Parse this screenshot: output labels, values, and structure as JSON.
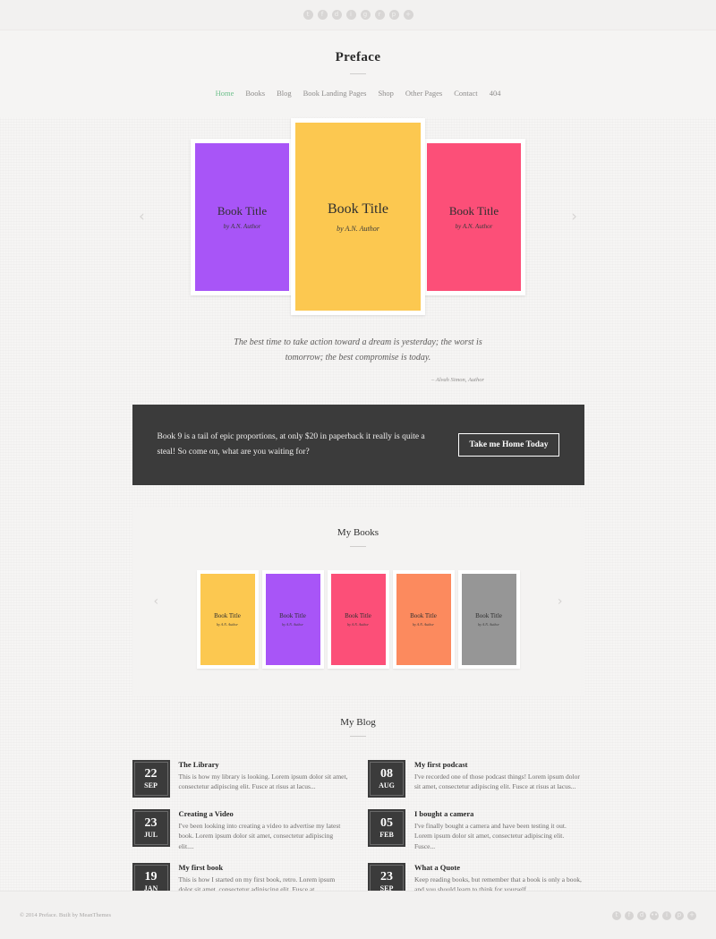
{
  "topbar": {
    "social_icons": [
      "twitter-icon",
      "facebook-icon",
      "dribbble-icon",
      "instagram-icon",
      "github-icon",
      "reddit-icon",
      "pinterest-icon",
      "google-plus-icon"
    ],
    "glyphs": [
      "t",
      "f",
      "d",
      "i",
      "g",
      "r",
      "p",
      "+"
    ]
  },
  "header": {
    "brand": "Preface",
    "nav": [
      {
        "label": "Home",
        "active": true
      },
      {
        "label": "Books",
        "active": false
      },
      {
        "label": "Blog",
        "active": false
      },
      {
        "label": "Book Landing Pages",
        "active": false
      },
      {
        "label": "Shop",
        "active": false
      },
      {
        "label": "Other Pages",
        "active": false
      },
      {
        "label": "Contact",
        "active": false
      },
      {
        "label": "404",
        "active": false
      }
    ],
    "active_color": "#6dbf8b"
  },
  "hero": {
    "prev_arrow": "‹",
    "next_arrow": "›",
    "books": [
      {
        "title": "Book Title",
        "author": "by A.N. Author",
        "color": "#A855F7"
      },
      {
        "title": "Book Title",
        "author": "by A.N. Author",
        "color": "#FCC850"
      },
      {
        "title": "Book Title",
        "author": "by A.N. Author",
        "color": "#FC4F78"
      }
    ]
  },
  "quote": {
    "text": "The best time to take action toward a dream is yesterday; the worst is tomorrow; the best compromise is today.",
    "attribution": "– Alvah Simon, Author"
  },
  "cta": {
    "text": "Book 9 is a tail of epic proportions, at only $20 in paperback it really is quite a steal! So come on, what are you waiting for?",
    "button_label": "Take me Home Today",
    "background": "#3b3b3b"
  },
  "my_books": {
    "title": "My Books",
    "prev_arrow": "‹",
    "next_arrow": "›",
    "books": [
      {
        "title": "Book Title",
        "author": "by A.N. Author",
        "color": "#FCC850"
      },
      {
        "title": "Book Title",
        "author": "by A.N. Author",
        "color": "#A855F7"
      },
      {
        "title": "Book Title",
        "author": "by A.N. Author",
        "color": "#FC4F78"
      },
      {
        "title": "Book Title",
        "author": "by A.N. Author",
        "color": "#FC8A5E"
      },
      {
        "title": "Book Title",
        "author": "by A.N. Author",
        "color": "#969696"
      }
    ]
  },
  "my_blog": {
    "title": "My Blog",
    "posts": [
      {
        "day": "22",
        "month": "SEP",
        "title": "The Library",
        "excerpt": "This is how my library is looking. Lorem ipsum dolor sit amet, consectetur adipiscing elit. Fusce at risus at lacus..."
      },
      {
        "day": "08",
        "month": "AUG",
        "title": "My first podcast",
        "excerpt": "I've recorded one of those podcast things! Lorem ipsum dolor sit amet, consectetur adipiscing elit. Fusce at risus at lacus..."
      },
      {
        "day": "23",
        "month": "JUL",
        "title": "Creating a Video",
        "excerpt": "I've been looking into creating a video to advertise my latest book. Lorem ipsum dolor sit amet, consectetur adipiscing elit...."
      },
      {
        "day": "05",
        "month": "FEB",
        "title": "I bought a camera",
        "excerpt": "I've finally bought a camera and have been testing it out. Lorem ipsum dolor sit amet, consectetur adipiscing elit. Fusce..."
      },
      {
        "day": "19",
        "month": "JAN",
        "title": "My first book",
        "excerpt": "This is how I started on my first book, retro. Lorem ipsum dolor sit amet, consectetur adipiscing elit. Fusce at..."
      },
      {
        "day": "23",
        "month": "SEP",
        "title": "What a Quote",
        "excerpt": "Keep reading books, but remember that a book is only a book, and you should learn to think for yourself."
      }
    ]
  },
  "footer": {
    "copyright": "© 2014 Preface. Built by MeanThemes",
    "social_icons": [
      "twitter-icon",
      "facebook-icon",
      "dribbble-icon",
      "flickr-icon",
      "instagram-icon",
      "pinterest-icon",
      "google-plus-icon"
    ],
    "glyphs": [
      "t",
      "f",
      "d",
      "••",
      "i",
      "p",
      "+"
    ]
  }
}
